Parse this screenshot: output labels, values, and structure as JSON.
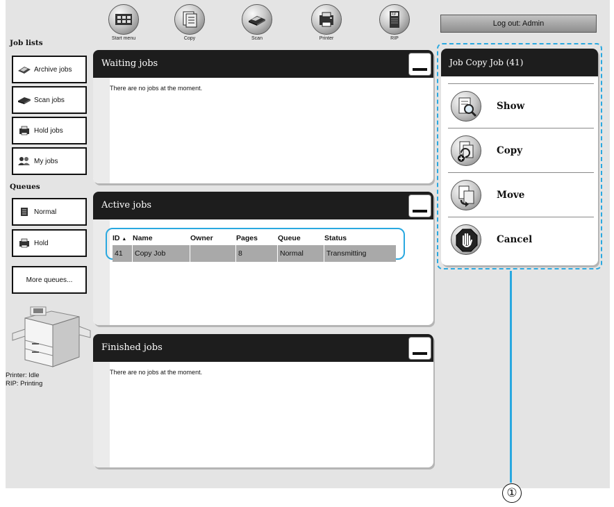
{
  "toolbar": {
    "items": [
      {
        "label": "Start menu",
        "icon": "start-menu-icon"
      },
      {
        "label": "Copy",
        "icon": "copy-icon"
      },
      {
        "label": "Scan",
        "icon": "scan-icon"
      },
      {
        "label": "Printer",
        "icon": "printer-icon"
      },
      {
        "label": "RIP",
        "icon": "rip-icon"
      }
    ],
    "logout_label": "Log out: Admin"
  },
  "sidebar": {
    "job_lists_title": "Job lists",
    "job_lists": [
      {
        "label": "Archive jobs",
        "icon": "archive-jobs-icon"
      },
      {
        "label": "Scan jobs",
        "icon": "scan-jobs-icon"
      },
      {
        "label": "Hold jobs",
        "icon": "hold-jobs-icon"
      },
      {
        "label": "My jobs",
        "icon": "my-jobs-icon"
      }
    ],
    "queues_title": "Queues",
    "queues": [
      {
        "label": "Normal",
        "icon": "normal-queue-icon"
      },
      {
        "label": "Hold",
        "icon": "hold-queue-icon"
      }
    ],
    "more_label": "More queues...",
    "printer_status": "Printer: Idle",
    "rip_status": "RIP: Printing"
  },
  "panels": {
    "waiting": {
      "title": "Waiting jobs",
      "empty_text": "There are no jobs at the moment."
    },
    "active": {
      "title": "Active jobs",
      "columns": [
        "ID",
        "Name",
        "Owner",
        "Pages",
        "Queue",
        "Status"
      ],
      "sort_indicator": "▲",
      "rows": [
        {
          "id": "41",
          "name": "Copy Job",
          "owner": "",
          "pages": "8",
          "queue": "Normal",
          "status": "Transmitting"
        }
      ]
    },
    "finished": {
      "title": "Finished jobs",
      "empty_text": "There are no jobs at the moment."
    }
  },
  "actions": {
    "title": "Job Copy Job (41)",
    "items": [
      {
        "label": "Show",
        "icon": "show-magnifier-icon"
      },
      {
        "label": "Copy",
        "icon": "copy-job-icon"
      },
      {
        "label": "Move",
        "icon": "move-job-icon"
      },
      {
        "label": "Cancel",
        "icon": "cancel-stop-icon"
      }
    ]
  },
  "callout": {
    "number": "①"
  },
  "colors": {
    "accent": "#29a8e0",
    "panel_header": "#1d1d1d",
    "background": "#e4e4e4",
    "selected_row": "#a9a9a9"
  }
}
